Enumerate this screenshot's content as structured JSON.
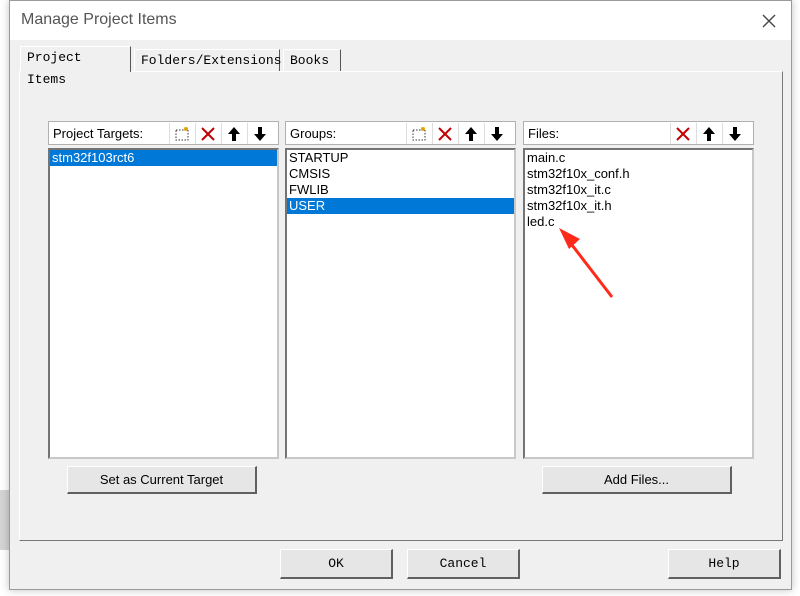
{
  "window": {
    "title": "Manage Project Items"
  },
  "tabs": [
    {
      "label": "Project Items"
    },
    {
      "label": "Folders/Extensions"
    },
    {
      "label": "Books"
    }
  ],
  "targets": {
    "label": "Project Targets:",
    "items": [
      "stm32f103rct6"
    ],
    "selected_index": 0,
    "button_label": "Set as Current Target"
  },
  "groups": {
    "label": "Groups:",
    "items": [
      "STARTUP",
      "CMSIS",
      "FWLIB",
      "USER"
    ],
    "selected_index": 3
  },
  "files": {
    "label": "Files:",
    "items": [
      "main.c",
      "stm32f10x_conf.h",
      "stm32f10x_it.c",
      "stm32f10x_it.h",
      "led.c"
    ],
    "button_label": "Add Files..."
  },
  "footer": {
    "ok_label": "OK",
    "cancel_label": "Cancel",
    "help_label": "Help"
  },
  "colors": {
    "selection": "#0078d7",
    "delete_icon": "#c00000",
    "arrow_annotation": "#ff2a1a"
  }
}
